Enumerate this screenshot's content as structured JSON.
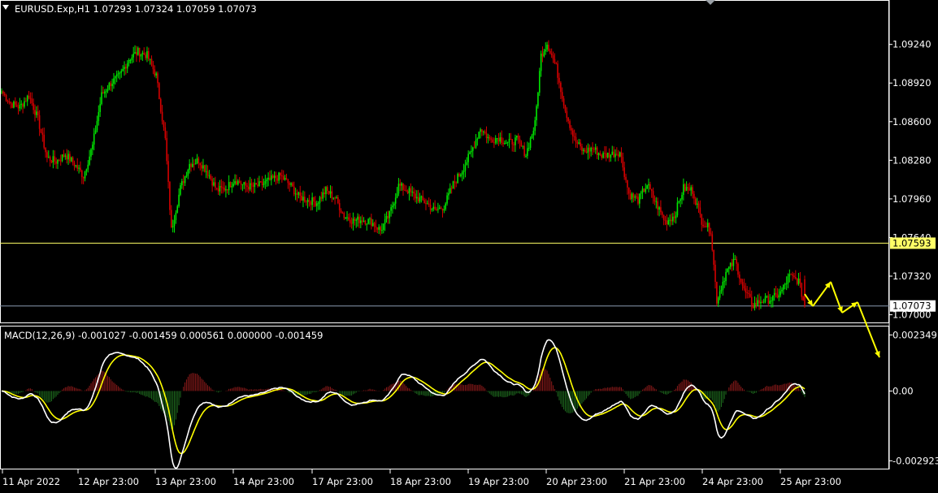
{
  "header": {
    "symbol_line": "EURUSD.Exp,H1  1.07293 1.07324 1.07059 1.07073"
  },
  "macd_header": {
    "text": "MACD(12,26,9) -0.001027 -0.001459 0.000561 0.000000 -0.001459"
  },
  "colors": {
    "background": "#000000",
    "frame": "#ffffff",
    "bull_candle": "#00e600",
    "bear_candle": "#d40000",
    "level_line": "#ffff66",
    "price_line": "#8a9bb0",
    "macd_main": "#ffffff",
    "macd_signal": "#ffff00",
    "hist_pos": "#8b1a1a",
    "hist_neg": "#1e6b1e",
    "arrow": "#ffff00"
  },
  "price_axis": {
    "labels": [
      "1.09240",
      "1.08920",
      "1.08600",
      "1.08280",
      "1.07960",
      "1.07640",
      "1.07320",
      "1.07000"
    ],
    "values": [
      1.0924,
      1.0892,
      1.086,
      1.0828,
      1.0796,
      1.0764,
      1.0732,
      1.07
    ],
    "level_value": 1.07593,
    "level_label": "1.07593",
    "current_value": 1.07073,
    "current_label": "1.07073",
    "range": [
      1.0697,
      1.0946
    ]
  },
  "macd_axis": {
    "labels": [
      "0.002349",
      "0.00",
      "-0.002923"
    ],
    "values": [
      0.002349,
      0.0,
      -0.002923
    ],
    "range": [
      -0.00315,
      0.0026
    ]
  },
  "time_axis": {
    "labels": [
      "11 Apr 2022",
      "12 Apr 23:00",
      "13 Apr 23:00",
      "14 Apr 23:00",
      "17 Apr 23:00",
      "18 Apr 23:00",
      "19 Apr 23:00",
      "20 Apr 23:00",
      "21 Apr 23:00",
      "24 Apr 23:00",
      "25 Apr 23:00"
    ]
  },
  "chart_data": {
    "type": "candlestick",
    "symbol": "EURUSD.Exp",
    "timeframe": "H1",
    "last_ohlc": {
      "open": 1.07293,
      "high": 1.07324,
      "low": 1.07059,
      "close": 1.07073
    },
    "horizontal_level": 1.07593,
    "close_anchors": [
      [
        0,
        1.0885
      ],
      [
        6,
        1.0875
      ],
      [
        12,
        1.0872
      ],
      [
        18,
        1.0882
      ],
      [
        24,
        1.0862
      ],
      [
        30,
        1.083
      ],
      [
        36,
        1.0827
      ],
      [
        42,
        1.0833
      ],
      [
        48,
        1.0825
      ],
      [
        54,
        1.0815
      ],
      [
        60,
        1.084
      ],
      [
        66,
        1.0882
      ],
      [
        72,
        1.0892
      ],
      [
        78,
        1.0898
      ],
      [
        84,
        1.0912
      ],
      [
        90,
        1.0918
      ],
      [
        96,
        1.0915
      ],
      [
        102,
        1.0898
      ],
      [
        108,
        1.0845
      ],
      [
        112,
        1.077
      ],
      [
        118,
        1.0805
      ],
      [
        124,
        1.0825
      ],
      [
        130,
        1.0828
      ],
      [
        136,
        1.0818
      ],
      [
        142,
        1.0803
      ],
      [
        148,
        1.0805
      ],
      [
        154,
        1.0812
      ],
      [
        160,
        1.0807
      ],
      [
        166,
        1.0806
      ],
      [
        172,
        1.0808
      ],
      [
        178,
        1.0812
      ],
      [
        184,
        1.0815
      ],
      [
        190,
        1.0808
      ],
      [
        196,
        1.0798
      ],
      [
        202,
        1.0795
      ],
      [
        208,
        1.0793
      ],
      [
        214,
        1.0803
      ],
      [
        220,
        1.0797
      ],
      [
        226,
        1.0782
      ],
      [
        232,
        1.0778
      ],
      [
        238,
        1.0779
      ],
      [
        244,
        1.0777
      ],
      [
        250,
        1.077
      ],
      [
        256,
        1.0783
      ],
      [
        262,
        1.0807
      ],
      [
        268,
        1.0803
      ],
      [
        274,
        1.0797
      ],
      [
        280,
        1.0793
      ],
      [
        286,
        1.0786
      ],
      [
        292,
        1.079
      ],
      [
        298,
        1.0808
      ],
      [
        304,
        1.082
      ],
      [
        310,
        1.0835
      ],
      [
        316,
        1.0855
      ],
      [
        322,
        1.0845
      ],
      [
        328,
        1.0847
      ],
      [
        334,
        1.0842
      ],
      [
        340,
        1.0845
      ],
      [
        346,
        1.0833
      ],
      [
        352,
        1.0858
      ],
      [
        356,
        1.0915
      ],
      [
        360,
        1.0925
      ],
      [
        366,
        1.0905
      ],
      [
        372,
        1.087
      ],
      [
        378,
        1.0845
      ],
      [
        384,
        1.0835
      ],
      [
        390,
        1.0838
      ],
      [
        396,
        1.0832
      ],
      [
        402,
        1.0833
      ],
      [
        408,
        1.0835
      ],
      [
        414,
        1.08
      ],
      [
        420,
        1.0795
      ],
      [
        426,
        1.0808
      ],
      [
        432,
        1.0792
      ],
      [
        438,
        1.0777
      ],
      [
        444,
        1.0782
      ],
      [
        450,
        1.0805
      ],
      [
        456,
        1.0803
      ],
      [
        462,
        1.0778
      ],
      [
        468,
        1.077
      ],
      [
        472,
        1.0712
      ],
      [
        478,
        1.0735
      ],
      [
        484,
        1.0745
      ],
      [
        490,
        1.072
      ],
      [
        496,
        1.0708
      ],
      [
        502,
        1.0712
      ],
      [
        508,
        1.0713
      ],
      [
        514,
        1.0718
      ],
      [
        520,
        1.0732
      ],
      [
        526,
        1.0728
      ],
      [
        530,
        1.0707
      ]
    ],
    "forecast_arrows": [
      "down",
      "up",
      "down",
      "up",
      "down"
    ],
    "macd": {
      "fast": 12,
      "slow": 26,
      "signal": 9,
      "header_values": [
        -0.001027,
        -0.001459,
        0.000561,
        0.0,
        -0.001459
      ]
    }
  }
}
